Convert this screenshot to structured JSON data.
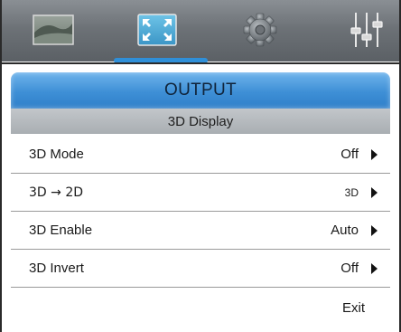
{
  "tabs": [
    {
      "name": "picture",
      "icon": "picture-icon",
      "active": false
    },
    {
      "name": "output",
      "icon": "fit-screen-icon",
      "active": true
    },
    {
      "name": "setup",
      "icon": "gear-icon",
      "active": false
    },
    {
      "name": "audio",
      "icon": "equalizer-icon",
      "active": false
    }
  ],
  "header": {
    "title": "OUTPUT",
    "subtitle": "3D Display"
  },
  "rows": [
    {
      "label": "3D Mode",
      "value": "Off"
    },
    {
      "label": "3D → 2D",
      "value": "3D"
    },
    {
      "label": "3D Enable",
      "value": "Auto"
    },
    {
      "label": "3D Invert",
      "value": "Off"
    }
  ],
  "exit_label": "Exit",
  "colors": {
    "accent": "#2f8fd8",
    "header_blue": "#3e8fd6",
    "tabbar_gray": "#6d7277",
    "subheader_gray": "#a9aeb2"
  }
}
